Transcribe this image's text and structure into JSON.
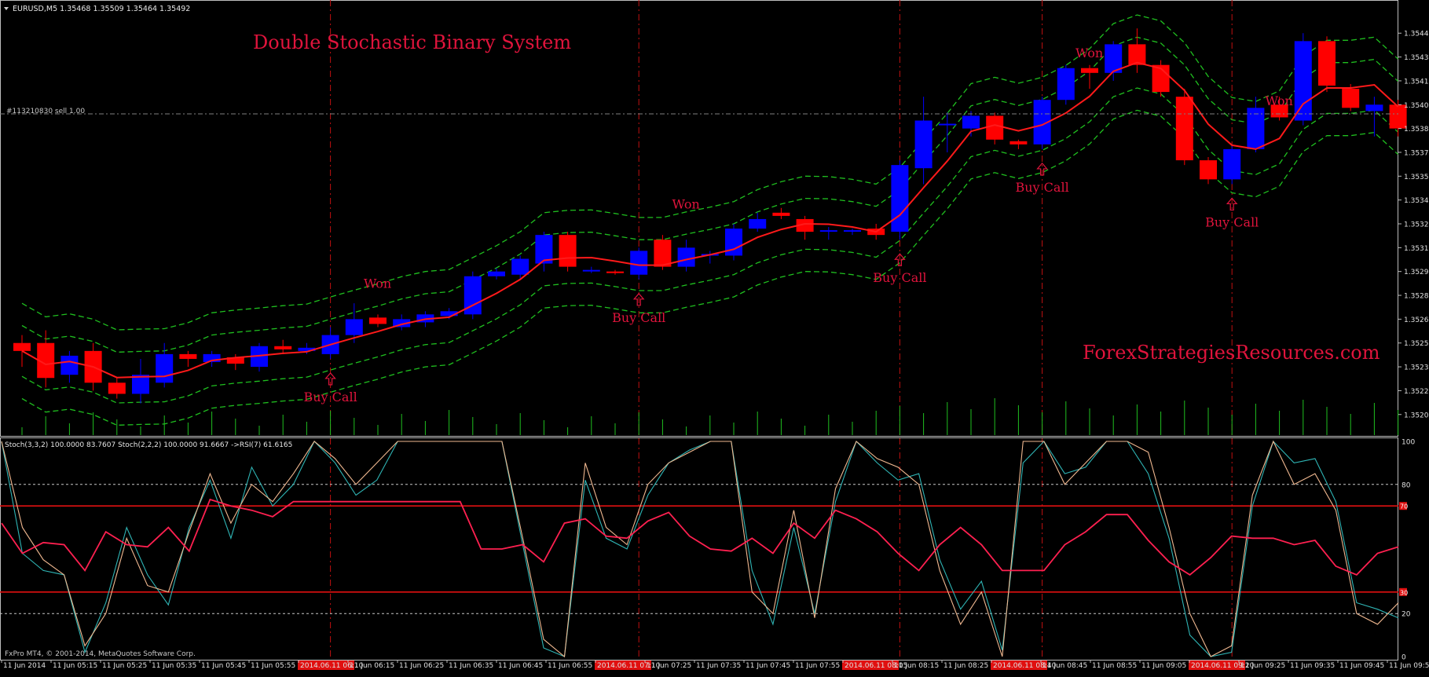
{
  "header": {
    "symbol_line": "EURUSD,M5  1.35468 1.35509 1.35464 1.35492",
    "title": "Double Stochastic Binary System",
    "order_label": "#113210830 sell 1.00",
    "watermark": "ForexStrategiesResources.com",
    "copyright": "FxPro MT4, © 2001-2014, MetaQuotes Software Corp."
  },
  "indicator": {
    "label": "Stoch(3,3,2) 100.0000 83.7607  Stoch(2,2,2) 100.0000 91.6667  ->RSI(7) 61.6165",
    "levels": [
      "100",
      "80",
      "70",
      "30",
      "20",
      "0"
    ]
  },
  "signals": {
    "buy_label": "Buy Call",
    "won_label": "Won"
  },
  "price_axis": [
    "1.35445",
    "1.35430",
    "1.35415",
    "1.35400",
    "1.35385",
    "1.35370",
    "1.35355",
    "1.35340",
    "1.35325",
    "1.35310",
    "1.35295",
    "1.35280",
    "1.35265",
    "1.35250",
    "1.35235",
    "1.35220",
    "1.35205"
  ],
  "time_axis": [
    {
      "label": "11 Jun 2014",
      "highlight": false
    },
    {
      "label": "11 Jun 05:15",
      "highlight": false
    },
    {
      "label": "11 Jun 05:25",
      "highlight": false
    },
    {
      "label": "11 Jun 05:35",
      "highlight": false
    },
    {
      "label": "11 Jun 05:45",
      "highlight": false
    },
    {
      "label": "11 Jun 05:55",
      "highlight": false
    },
    {
      "label": "2014.06.11 06:10",
      "highlight": true
    },
    {
      "label": "11 Jun 06:15",
      "highlight": false
    },
    {
      "label": "11 Jun 06:25",
      "highlight": false
    },
    {
      "label": "11 Jun 06:35",
      "highlight": false
    },
    {
      "label": "11 Jun 06:45",
      "highlight": false
    },
    {
      "label": "11 Jun 06:55",
      "highlight": false
    },
    {
      "label": "2014.06.11 07:10",
      "highlight": true
    },
    {
      "label": "11 Jun 07:25",
      "highlight": false
    },
    {
      "label": "11 Jun 07:35",
      "highlight": false
    },
    {
      "label": "11 Jun 07:45",
      "highlight": false
    },
    {
      "label": "11 Jun 07:55",
      "highlight": false
    },
    {
      "label": "2014.06.11 08:05",
      "highlight": true
    },
    {
      "label": "11 Jun 08:15",
      "highlight": false
    },
    {
      "label": "11 Jun 08:25",
      "highlight": false
    },
    {
      "label": "2014.06.11 08:40",
      "highlight": true
    },
    {
      "label": "11 Jun 08:45",
      "highlight": false
    },
    {
      "label": "11 Jun 08:55",
      "highlight": false
    },
    {
      "label": "11 Jun 09:05",
      "highlight": false
    },
    {
      "label": "2014.06.11 09:20",
      "highlight": true
    },
    {
      "label": "11 Jun 09:25",
      "highlight": false
    },
    {
      "label": "11 Jun 09:35",
      "highlight": false
    },
    {
      "label": "11 Jun 09:45",
      "highlight": false
    },
    {
      "label": "11 Jun 09:5",
      "highlight": false
    }
  ],
  "colors": {
    "background": "#000000",
    "bull_candle": "#0000ff",
    "bear_candle": "#ff0000",
    "ma_line": "#ff1a1a",
    "band_line": "#1fbf1f",
    "signal_text": "#e0143c",
    "stoch_fast": "#2fb5b5",
    "stoch_slow": "#f0b890",
    "rsi_line": "#ff2050"
  },
  "chart_data": {
    "type": "candlestick",
    "symbol": "EURUSD",
    "timeframe": "M5",
    "price_range": [
      1.35195,
      1.35455
    ],
    "candles": [
      {
        "o": 1.3525,
        "h": 1.35255,
        "l": 1.35235,
        "c": 1.35245
      },
      {
        "o": 1.3525,
        "h": 1.35258,
        "l": 1.35222,
        "c": 1.35228
      },
      {
        "o": 1.3523,
        "h": 1.35245,
        "l": 1.35225,
        "c": 1.35242
      },
      {
        "o": 1.35245,
        "h": 1.3525,
        "l": 1.3522,
        "c": 1.35225
      },
      {
        "o": 1.35225,
        "h": 1.35228,
        "l": 1.35215,
        "c": 1.35218
      },
      {
        "o": 1.35218,
        "h": 1.3524,
        "l": 1.35212,
        "c": 1.3523
      },
      {
        "o": 1.35225,
        "h": 1.3525,
        "l": 1.35222,
        "c": 1.35243
      },
      {
        "o": 1.35243,
        "h": 1.35245,
        "l": 1.35235,
        "c": 1.3524
      },
      {
        "o": 1.35238,
        "h": 1.35245,
        "l": 1.35235,
        "c": 1.35243
      },
      {
        "o": 1.35241,
        "h": 1.35243,
        "l": 1.35233,
        "c": 1.35237
      },
      {
        "o": 1.35235,
        "h": 1.3525,
        "l": 1.35232,
        "c": 1.35248
      },
      {
        "o": 1.35248,
        "h": 1.35252,
        "l": 1.35243,
        "c": 1.35246
      },
      {
        "o": 1.35245,
        "h": 1.3525,
        "l": 1.35243,
        "c": 1.35247
      },
      {
        "o": 1.35243,
        "h": 1.3526,
        "l": 1.3524,
        "c": 1.35255
      },
      {
        "o": 1.35255,
        "h": 1.35275,
        "l": 1.3525,
        "c": 1.35265
      },
      {
        "o": 1.35266,
        "h": 1.35268,
        "l": 1.3526,
        "c": 1.35262
      },
      {
        "o": 1.3526,
        "h": 1.35268,
        "l": 1.35258,
        "c": 1.35265
      },
      {
        "o": 1.35263,
        "h": 1.3527,
        "l": 1.3526,
        "c": 1.35268
      },
      {
        "o": 1.35267,
        "h": 1.35272,
        "l": 1.35265,
        "c": 1.3527
      },
      {
        "o": 1.35268,
        "h": 1.35295,
        "l": 1.35265,
        "c": 1.35292
      },
      {
        "o": 1.35292,
        "h": 1.35297,
        "l": 1.3529,
        "c": 1.35295
      },
      {
        "o": 1.35293,
        "h": 1.35305,
        "l": 1.3529,
        "c": 1.35303
      },
      {
        "o": 1.353,
        "h": 1.3532,
        "l": 1.35295,
        "c": 1.35318
      },
      {
        "o": 1.35318,
        "h": 1.3532,
        "l": 1.35295,
        "c": 1.35298
      },
      {
        "o": 1.35296,
        "h": 1.35298,
        "l": 1.35294,
        "c": 1.35296
      },
      {
        "o": 1.35295,
        "h": 1.35296,
        "l": 1.35293,
        "c": 1.35294
      },
      {
        "o": 1.35293,
        "h": 1.3531,
        "l": 1.3529,
        "c": 1.35308
      },
      {
        "o": 1.35315,
        "h": 1.35318,
        "l": 1.35296,
        "c": 1.35298
      },
      {
        "o": 1.35298,
        "h": 1.35315,
        "l": 1.35295,
        "c": 1.3531
      },
      {
        "o": 1.35305,
        "h": 1.35308,
        "l": 1.353,
        "c": 1.35306
      },
      {
        "o": 1.35305,
        "h": 1.35325,
        "l": 1.35302,
        "c": 1.35322
      },
      {
        "o": 1.35322,
        "h": 1.35332,
        "l": 1.3532,
        "c": 1.35328
      },
      {
        "o": 1.35332,
        "h": 1.35335,
        "l": 1.35328,
        "c": 1.3533
      },
      {
        "o": 1.35328,
        "h": 1.3533,
        "l": 1.35315,
        "c": 1.3532
      },
      {
        "o": 1.3532,
        "h": 1.35323,
        "l": 1.35315,
        "c": 1.35321
      },
      {
        "o": 1.35321,
        "h": 1.35322,
        "l": 1.35318,
        "c": 1.35321
      },
      {
        "o": 1.35322,
        "h": 1.35325,
        "l": 1.35315,
        "c": 1.35318
      },
      {
        "o": 1.3532,
        "h": 1.35365,
        "l": 1.35315,
        "c": 1.35362
      },
      {
        "o": 1.3536,
        "h": 1.35405,
        "l": 1.3535,
        "c": 1.3539
      },
      {
        "o": 1.35388,
        "h": 1.35395,
        "l": 1.3537,
        "c": 1.35388
      },
      {
        "o": 1.35385,
        "h": 1.35396,
        "l": 1.3538,
        "c": 1.35393
      },
      {
        "o": 1.35393,
        "h": 1.35395,
        "l": 1.35375,
        "c": 1.35378
      },
      {
        "o": 1.35377,
        "h": 1.35378,
        "l": 1.35372,
        "c": 1.35375
      },
      {
        "o": 1.35375,
        "h": 1.35405,
        "l": 1.35372,
        "c": 1.35403
      },
      {
        "o": 1.35403,
        "h": 1.35425,
        "l": 1.354,
        "c": 1.35423
      },
      {
        "o": 1.35423,
        "h": 1.35425,
        "l": 1.3541,
        "c": 1.3542
      },
      {
        "o": 1.3542,
        "h": 1.3544,
        "l": 1.35415,
        "c": 1.35438
      },
      {
        "o": 1.35438,
        "h": 1.35448,
        "l": 1.3542,
        "c": 1.35425
      },
      {
        "o": 1.35425,
        "h": 1.35428,
        "l": 1.35405,
        "c": 1.35408
      },
      {
        "o": 1.35405,
        "h": 1.3541,
        "l": 1.35362,
        "c": 1.35365
      },
      {
        "o": 1.35365,
        "h": 1.35367,
        "l": 1.3535,
        "c": 1.35353
      },
      {
        "o": 1.35353,
        "h": 1.35375,
        "l": 1.3535,
        "c": 1.35372
      },
      {
        "o": 1.35372,
        "h": 1.35405,
        "l": 1.3537,
        "c": 1.35398
      },
      {
        "o": 1.354,
        "h": 1.35405,
        "l": 1.3539,
        "c": 1.35392
      },
      {
        "o": 1.3539,
        "h": 1.35445,
        "l": 1.35387,
        "c": 1.3544
      },
      {
        "o": 1.3544,
        "h": 1.35443,
        "l": 1.35408,
        "c": 1.35412
      },
      {
        "o": 1.3541,
        "h": 1.35413,
        "l": 1.35396,
        "c": 1.35398
      },
      {
        "o": 1.35396,
        "h": 1.35405,
        "l": 1.3538,
        "c": 1.354
      },
      {
        "o": 1.354,
        "h": 1.35403,
        "l": 1.3538,
        "c": 1.35385
      }
    ],
    "signals": [
      {
        "type": "Buy Call",
        "candle": 13,
        "result": "Won"
      },
      {
        "type": "Buy Call",
        "candle": 26,
        "result": "Won"
      },
      {
        "type": "Buy Call",
        "candle": 37,
        "result": null
      },
      {
        "type": "Buy Call",
        "candle": 43,
        "result": "Won"
      },
      {
        "type": "Buy Call",
        "candle": 51,
        "result": "Won"
      }
    ],
    "indicator_range": [
      0,
      100
    ],
    "stoch_3_3_2": [
      100,
      48,
      40,
      38,
      2,
      25,
      60,
      38,
      24,
      60,
      82,
      55,
      88,
      70,
      80,
      100,
      90,
      75,
      82,
      100,
      100,
      100,
      100,
      100,
      100,
      52,
      4,
      0,
      82,
      55,
      50,
      75,
      90,
      96,
      100,
      100,
      40,
      15,
      60,
      20,
      72,
      100,
      90,
      82,
      85,
      45,
      22,
      35,
      3,
      90,
      100,
      85,
      88,
      100,
      100,
      85,
      55,
      10,
      0,
      2,
      70,
      100,
      90,
      92,
      72,
      25,
      22,
      18
    ],
    "stoch_2_2_2": [
      100,
      60,
      45,
      38,
      5,
      20,
      55,
      33,
      30,
      58,
      85,
      62,
      80,
      72,
      85,
      100,
      92,
      80,
      90,
      100,
      100,
      100,
      100,
      100,
      100,
      55,
      8,
      0,
      90,
      60,
      52,
      80,
      90,
      95,
      100,
      100,
      30,
      20,
      68,
      18,
      78,
      100,
      92,
      88,
      80,
      40,
      15,
      30,
      0,
      100,
      100,
      80,
      90,
      100,
      100,
      95,
      60,
      20,
      0,
      5,
      75,
      100,
      80,
      85,
      68,
      20,
      15,
      25
    ],
    "rsi_7": [
      62,
      48,
      53,
      52,
      40,
      58,
      52,
      51,
      60,
      49,
      73,
      70,
      68,
      65,
      72,
      72,
      72,
      72,
      72,
      72,
      72,
      72,
      72,
      50,
      50,
      52,
      44,
      62,
      64,
      56,
      55,
      63,
      67,
      56,
      50,
      49,
      55,
      48,
      62,
      55,
      68,
      64,
      58,
      48,
      40,
      52,
      60,
      52,
      40,
      40,
      40,
      52,
      58,
      66,
      66,
      54,
      44,
      38,
      46,
      56,
      55,
      55,
      52,
      54,
      42,
      38,
      48,
      51
    ],
    "levels": [
      80,
      70,
      30,
      20
    ]
  }
}
